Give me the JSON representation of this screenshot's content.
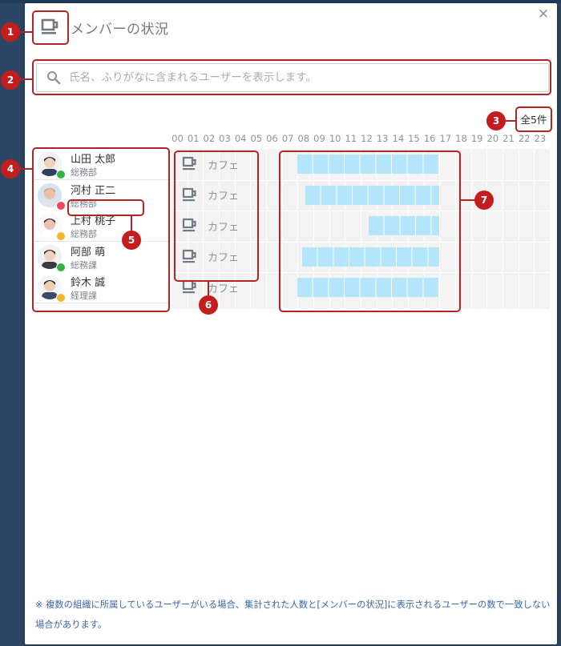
{
  "dialog": {
    "title": "メンバーの状況",
    "close_symbol": "✕"
  },
  "search": {
    "placeholder": "氏名、ふりがなに含まれるユーザーを表示します。",
    "value": ""
  },
  "total_count": "全5件",
  "hours": [
    "00",
    "01",
    "02",
    "03",
    "04",
    "05",
    "06",
    "07",
    "08",
    "09",
    "10",
    "11",
    "12",
    "13",
    "14",
    "15",
    "16",
    "17",
    "18",
    "19",
    "20",
    "21",
    "22",
    "23"
  ],
  "members": [
    {
      "name": "山田 太郎",
      "dept": "総務部",
      "presence": "available",
      "presence_color": "#2fb344",
      "status": "カフェ",
      "active_hours": [
        8.0,
        17.0
      ]
    },
    {
      "name": "河村 正二",
      "dept": "総務部",
      "presence": "busy",
      "presence_color": "#ef4a5a",
      "status": "カフェ",
      "active_hours": [
        8.5,
        17.0
      ]
    },
    {
      "name": "上村 桃子",
      "dept": "総務部",
      "presence": "away",
      "presence_color": "#f2b62b",
      "status": "カフェ",
      "active_hours": [
        12.5,
        17.0
      ]
    },
    {
      "name": "阿部 萌",
      "dept": "総務課",
      "presence": "available",
      "presence_color": "#2fb344",
      "status": "カフェ",
      "active_hours": [
        8.3,
        17.0
      ]
    },
    {
      "name": "鈴木 誠",
      "dept": "経理課",
      "presence": "away",
      "presence_color": "#f2b62b",
      "status": "カフェ",
      "active_hours": [
        8.0,
        17.0
      ]
    }
  ],
  "callouts": [
    "1",
    "2",
    "3",
    "4",
    "5",
    "6",
    "7"
  ],
  "footnote": "※ 複数の組織に所属しているユーザーがいる場合、集計された人数と[メンバーの状況]に表示されるユーザーの数で一致しない場合があります。",
  "icons": {
    "header": "coffee-cup-icon",
    "search": "search-icon",
    "status": "coffee-cup-icon",
    "close": "close-icon"
  },
  "colors": {
    "callout": "#c41d1d",
    "bar": "#b5e5fb",
    "footnote": "#3c66a6"
  }
}
